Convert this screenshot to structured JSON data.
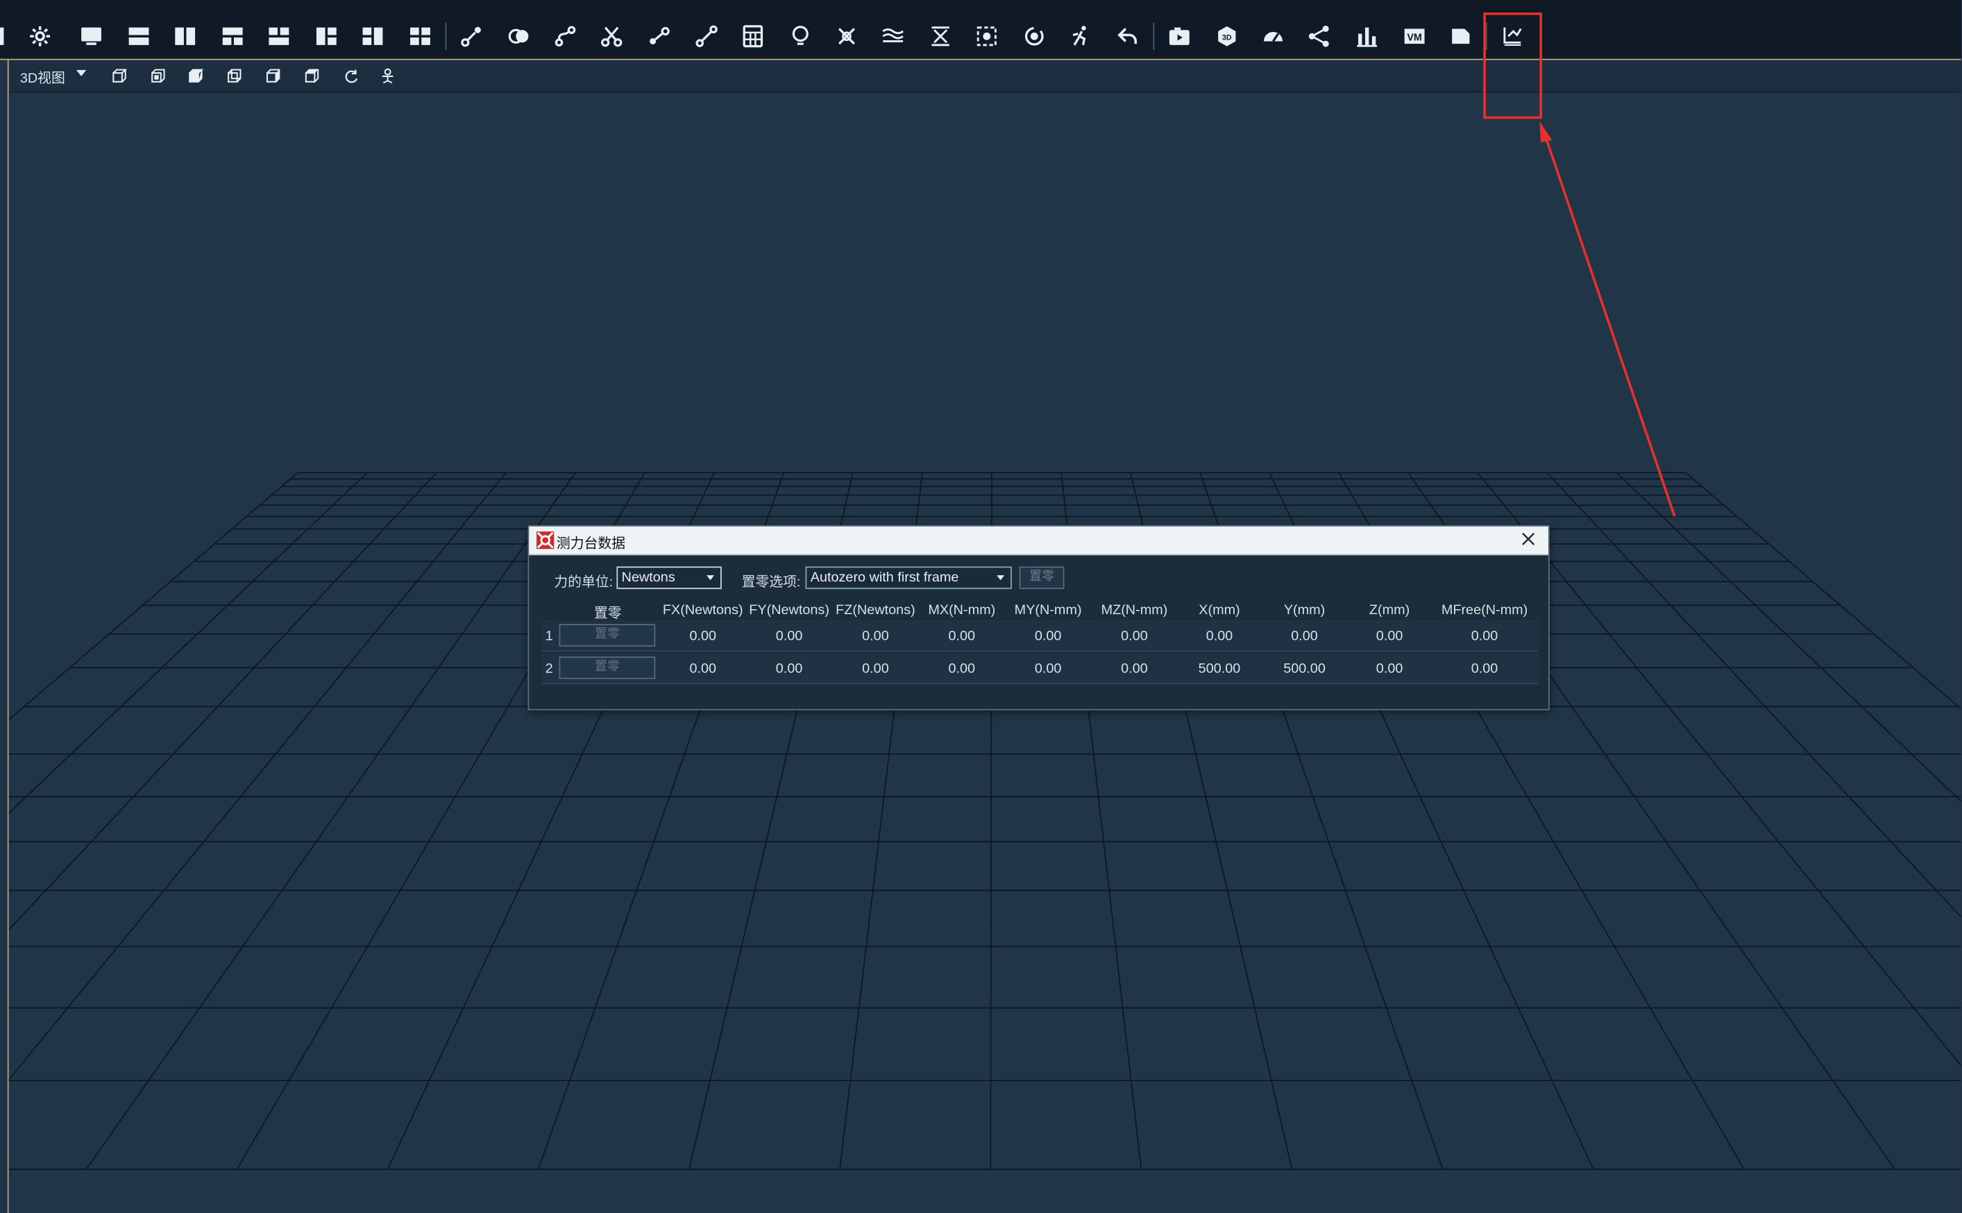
{
  "toolbar": {
    "icons": [
      "settings-icon",
      "monitor-icon",
      "layout-two-rows-icon",
      "layout-two-columns-icon",
      "layout-three-grid-icon",
      "layout-top-split-icon",
      "layout-left-split-icon",
      "layout-right-split-icon",
      "layout-four-grid-icon",
      "segment-link-icon",
      "overlap-circles-icon",
      "curve-link-icon",
      "cut-icon",
      "link-nodes-icon",
      "link-line-icon",
      "calculator-icon",
      "bulb-icon",
      "cross-marker-icon",
      "wave-icon",
      "filter-cut-icon",
      "focus-target-icon",
      "rotate-target-icon",
      "runner-icon",
      "undo-icon",
      "camera-play-icon",
      "view-3d-icon",
      "speedometer-icon",
      "share-nodes-icon",
      "bar-chart-icon",
      "vm-icon",
      "document-icon",
      "force-plate-icon"
    ],
    "highlight_color": "#e8302b"
  },
  "viewbar": {
    "view_label": "3D视图",
    "icons": [
      "cube-front-icon",
      "cube-side-icon",
      "cube-top-icon",
      "cube-back-icon",
      "cube-left-icon",
      "cube-right-icon",
      "refresh-view-icon",
      "camera-mount-icon"
    ]
  },
  "dialog": {
    "title": "测力台数据",
    "force_unit_label": "力的单位:",
    "force_unit_value": "Newtons",
    "zero_option_label": "置零选项:",
    "zero_option_value": "Autozero with first frame",
    "zero_button": "置零",
    "columns": [
      "置零",
      "FX(Newtons)",
      "FY(Newtons)",
      "FZ(Newtons)",
      "MX(N-mm)",
      "MY(N-mm)",
      "MZ(N-mm)",
      "X(mm)",
      "Y(mm)",
      "Z(mm)",
      "MFree(N-mm)"
    ],
    "rows": [
      {
        "index": "1",
        "zero_label": "置零",
        "values": [
          "0.00",
          "0.00",
          "0.00",
          "0.00",
          "0.00",
          "0.00",
          "0.00",
          "0.00",
          "0.00",
          "0.00"
        ]
      },
      {
        "index": "2",
        "zero_label": "置零",
        "values": [
          "0.00",
          "0.00",
          "0.00",
          "0.00",
          "0.00",
          "0.00",
          "500.00",
          "500.00",
          "0.00",
          "0.00"
        ]
      }
    ]
  }
}
